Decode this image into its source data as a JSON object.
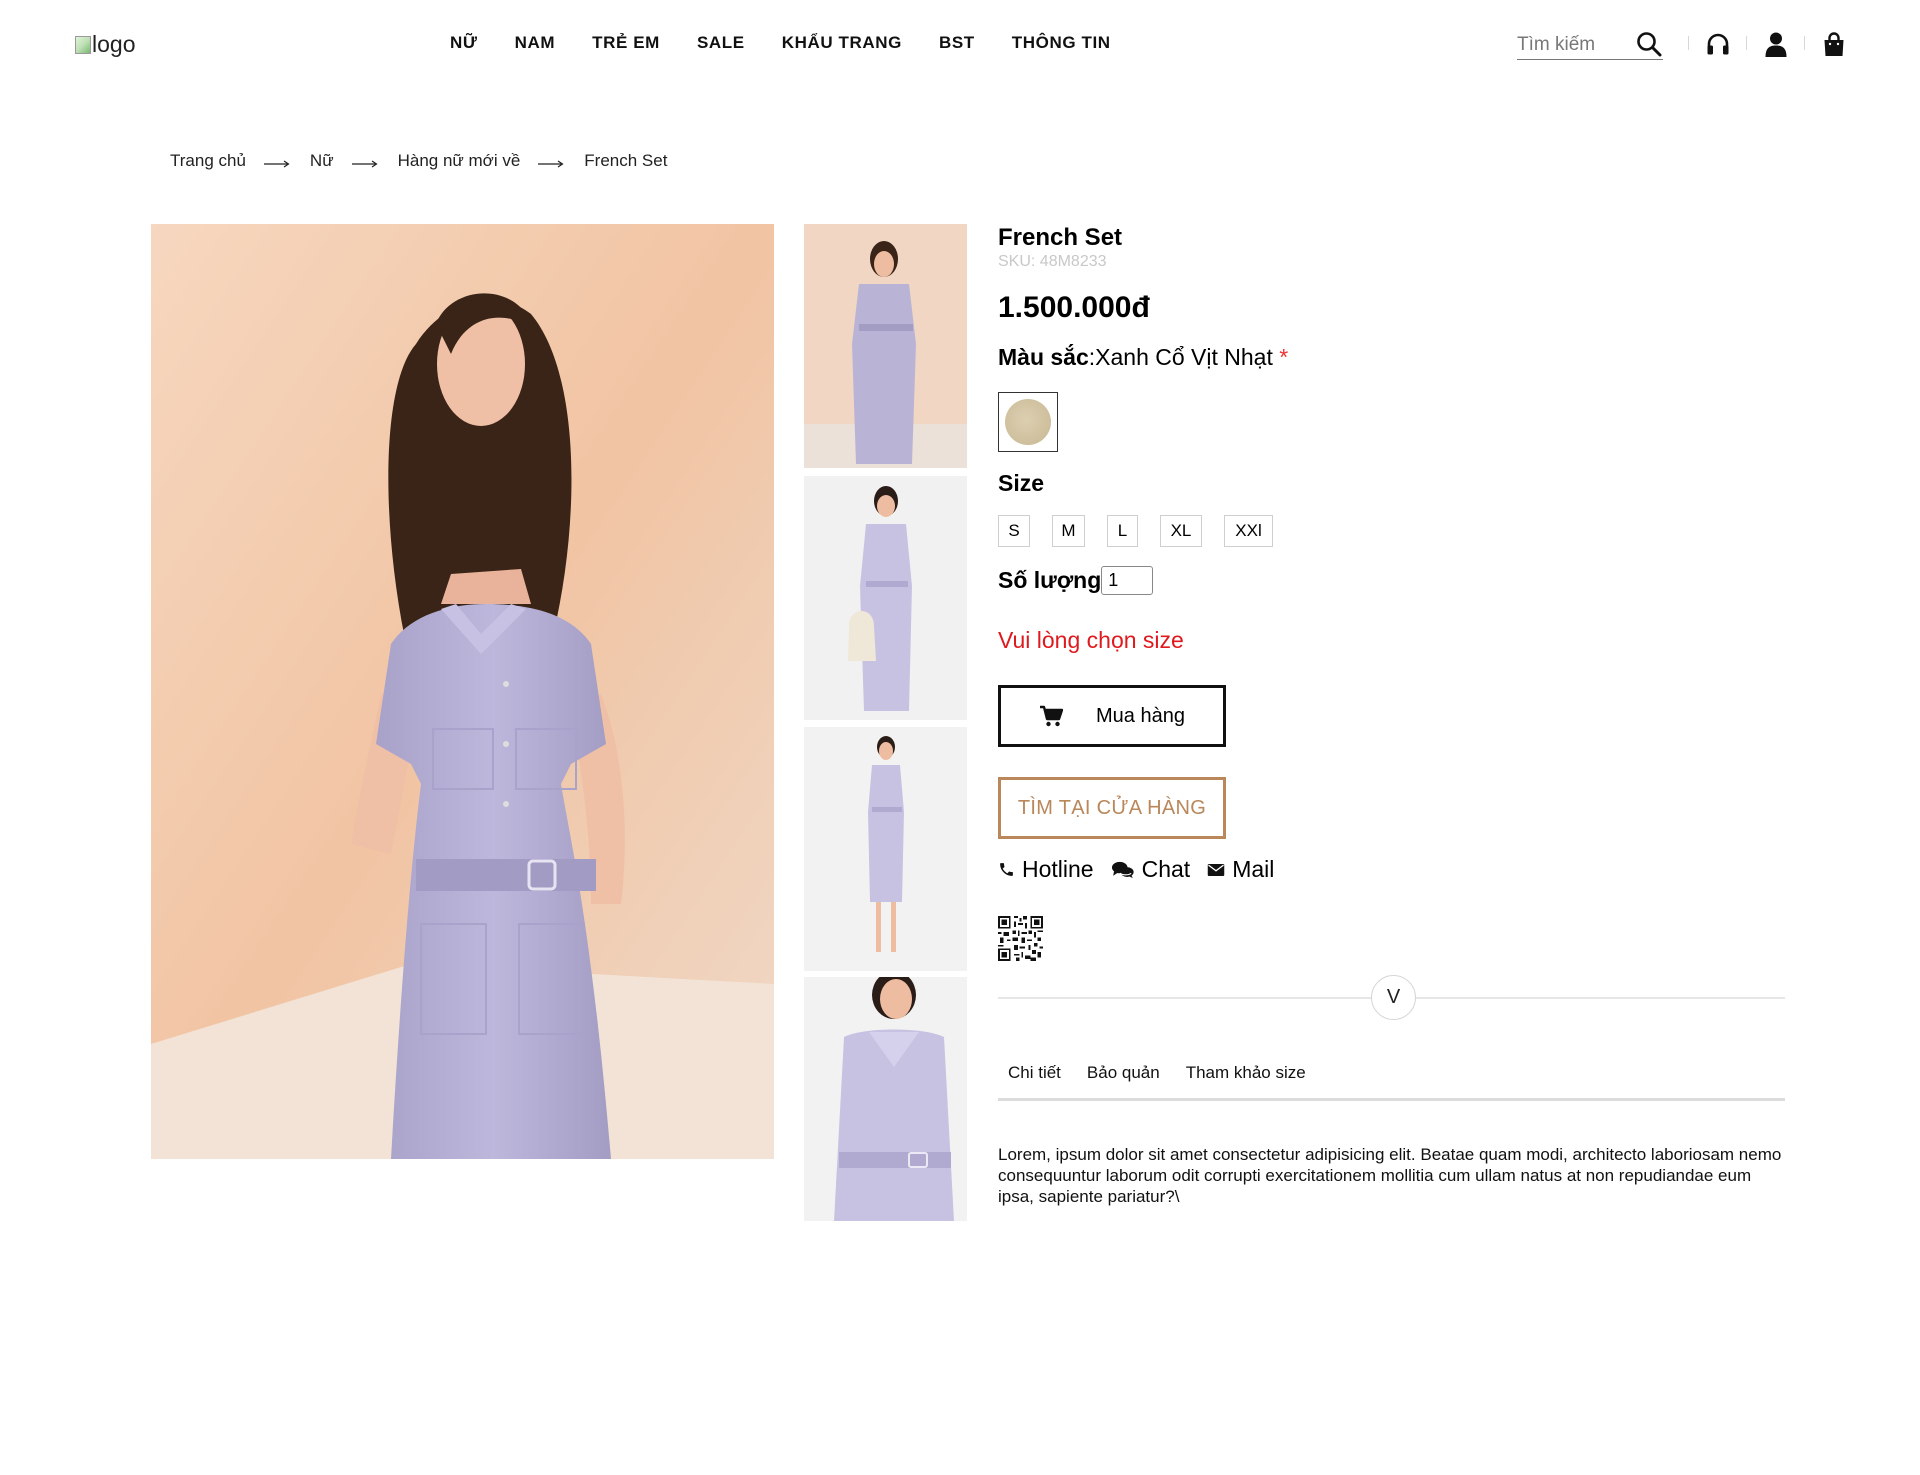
{
  "header": {
    "logo_alt": "logo",
    "nav": [
      "NỮ",
      "NAM",
      "TRẺ EM",
      "SALE",
      "KHẨU TRANG",
      "BST",
      "THÔNG TIN"
    ],
    "search_placeholder": "Tìm kiếm"
  },
  "breadcrumb": [
    "Trang chủ",
    "Nữ",
    "Hàng nữ mới về",
    "French Set"
  ],
  "product": {
    "name": "French Set",
    "sku": "SKU: 48M8233",
    "price": "1.500.000đ",
    "color_label": "Màu sắc",
    "color_separator": ":",
    "color_value": "Xanh Cổ Vịt Nhạt",
    "required_mark": "*",
    "swatch_color": "#d6c8a8",
    "size_label": "Size",
    "sizes": [
      "S",
      "M",
      "L",
      "XL",
      "XXl"
    ],
    "quantity_label": "Số lượng",
    "quantity_value": "1",
    "error": "Vui lòng chọn size",
    "buy_label": "Mua hàng",
    "store_label": "TÌM TẠI CỬA HÀNG",
    "contact": {
      "hotline": "Hotline",
      "chat": "Chat",
      "mail": "Mail"
    },
    "toggle_label": "V",
    "tabs": [
      "Chi tiết",
      "Bảo quản",
      "Tham khảo size"
    ],
    "description": "Lorem, ipsum dolor sit amet consectetur adipisicing elit. Beatae quam modi, architecto laboriosam nemo consequuntur laborum odit corrupti exercitationem mollitia cum ullam natus at non repudiandae eum ipsa, sapiente pariatur?\\"
  },
  "colors": {
    "accent_brown": "#b9875a",
    "error_red": "#e0191e",
    "dress_lavender": "#b9b3d6",
    "background_peach": "#f2c6a4"
  }
}
